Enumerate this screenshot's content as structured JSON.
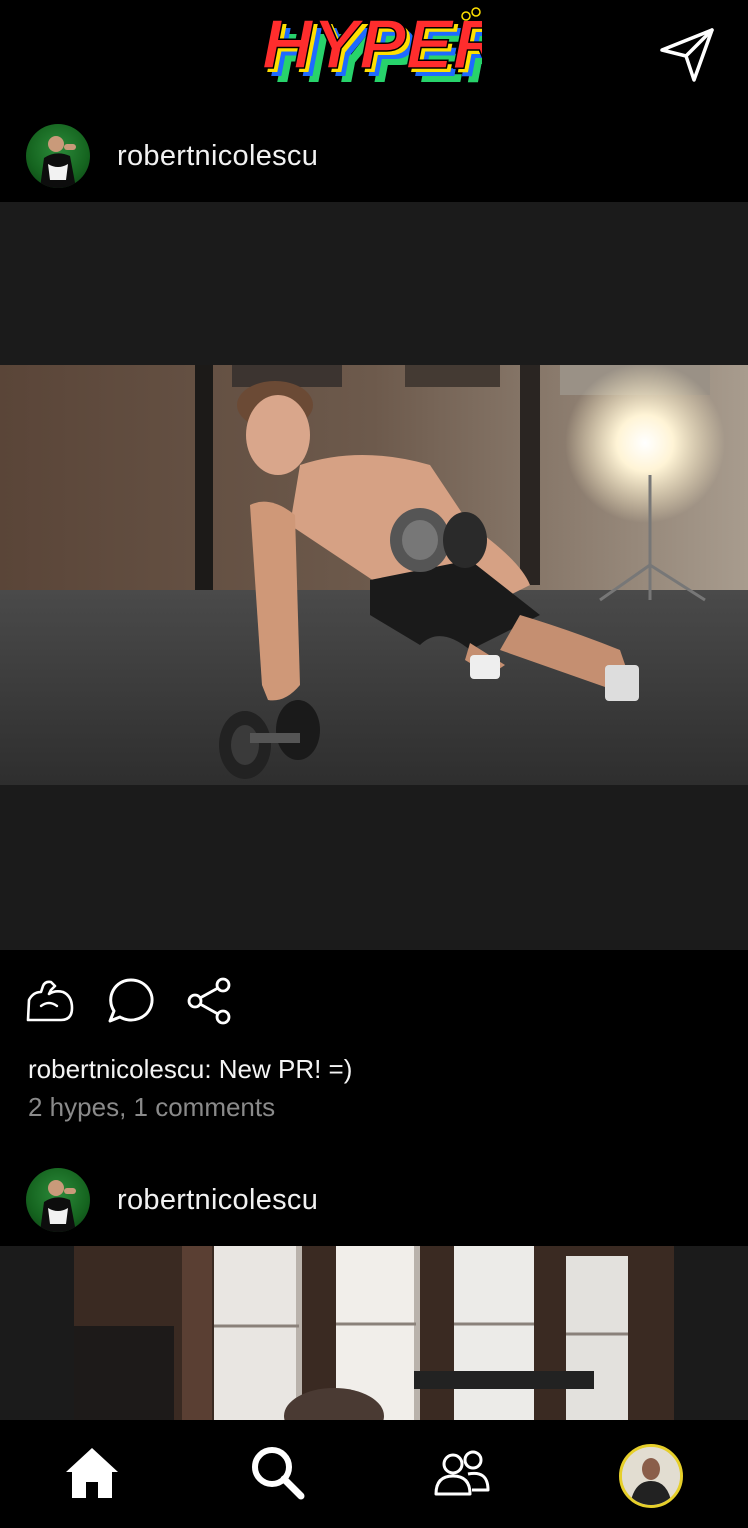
{
  "app": {
    "logo_text": "HYPER",
    "logo_colors": [
      "#ff2d2d",
      "#1e6bff",
      "#ffe000",
      "#27d36b"
    ]
  },
  "top_bar": {
    "send_icon": "paper-plane-icon"
  },
  "posts": [
    {
      "username": "robertnicolescu",
      "image_icon": "photo-pushup-dumbbell",
      "caption": "robertnicolescu: New PR! =)",
      "stats": "2 hypes, 1 comments",
      "actions": [
        {
          "name": "hype",
          "icon": "flexed-bicep-icon"
        },
        {
          "name": "comment",
          "icon": "speech-bubble-icon"
        },
        {
          "name": "share",
          "icon": "share-icon"
        }
      ]
    },
    {
      "username": "robertnicolescu",
      "image_icon": "photo-gym-window"
    }
  ],
  "bottom_nav": [
    {
      "name": "home",
      "icon": "home-icon"
    },
    {
      "name": "search",
      "icon": "search-icon"
    },
    {
      "name": "friends",
      "icon": "people-icon"
    },
    {
      "name": "profile",
      "icon": "profile-avatar"
    }
  ],
  "colors": {
    "background": "#000000",
    "media_background": "#1b1b1b",
    "text_primary": "#f4f4f4",
    "text_secondary": "#8a8a8a",
    "profile_ring": "#e6cf2a"
  }
}
